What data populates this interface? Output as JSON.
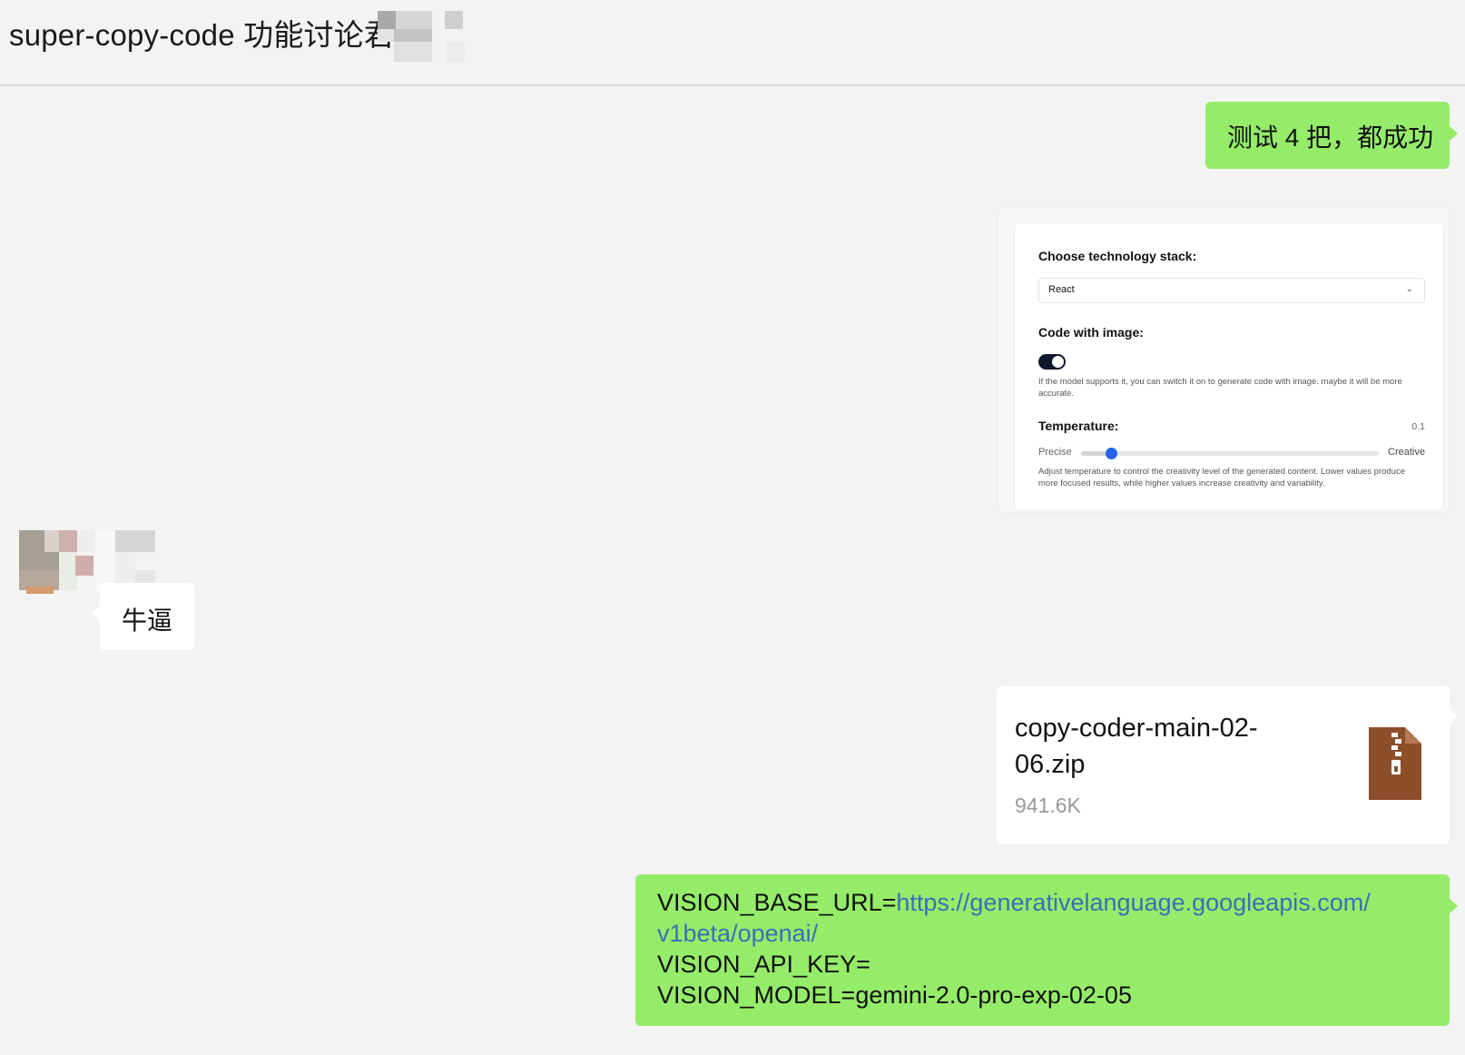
{
  "header": {
    "title": "super-copy-code 功能讨论君"
  },
  "messages": {
    "test_result": "测试 4 把，都成功",
    "screenshot": {
      "tech_stack_label": "Choose technology stack:",
      "tech_stack_value": "React",
      "code_with_image_label": "Code with image:",
      "code_with_image_enabled": true,
      "code_with_image_help": "If the model supports it, you can switch it on to generate code with image. maybe it will be more accurate.",
      "temperature_label": "Temperature:",
      "temperature_value": "0.1",
      "temperature_min_label": "Precise",
      "temperature_max_label": "Creative",
      "temperature_fraction": 0.1,
      "temperature_help": "Adjust temperature to control the creativity level of the generated content. Lower values produce more focused results, while higher values increase creativity and variability."
    },
    "reply": "牛逼",
    "file": {
      "name": "copy-coder-main-02-06.zip",
      "size": "941.6K",
      "icon": "zip-archive-icon"
    },
    "env": {
      "base_url_key": "VISION_BASE_URL=",
      "base_url_value": "https://generativelanguage.googleapis.com/",
      "base_url_value_cont": "v1beta/openai/",
      "api_key_line": "VISION_API_KEY=",
      "model_line": "VISION_MODEL=gemini-2.0-pro-exp-02-05"
    }
  },
  "colors": {
    "background": "#f3f3f3",
    "self_bubble": "#95ec69",
    "other_bubble": "#ffffff",
    "link": "#3b6fb6",
    "slider_thumb": "#2563eb",
    "zip_icon": "#8d4e2a"
  }
}
